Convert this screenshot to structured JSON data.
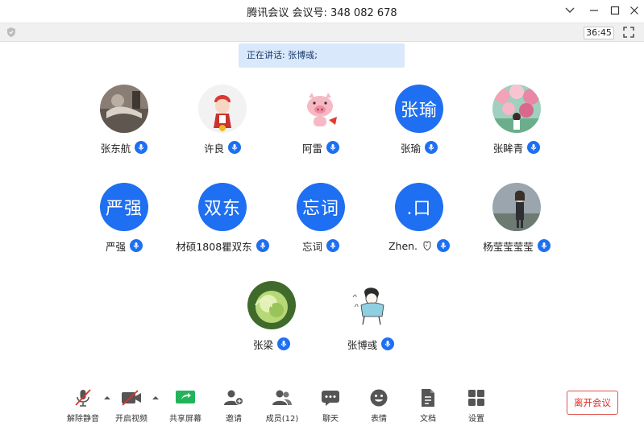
{
  "window": {
    "title_app": "腾讯会议",
    "title_meeting_label": "会议号:",
    "title_meeting_id": "348 082 678"
  },
  "subbar": {
    "timer": "36:45"
  },
  "speaking": {
    "label": "正在讲话:",
    "names": "张博彧;"
  },
  "participants": [
    {
      "name": "张东航",
      "avatar_type": "photo",
      "avatar_text": ""
    },
    {
      "name": "许良",
      "avatar_type": "photo",
      "avatar_text": ""
    },
    {
      "name": "阿雷",
      "avatar_type": "photo",
      "avatar_text": ""
    },
    {
      "name": "张瑜",
      "avatar_type": "text",
      "avatar_text": "张瑜"
    },
    {
      "name": "张眸青",
      "avatar_type": "photo",
      "avatar_text": ""
    },
    {
      "name": "严强",
      "avatar_type": "text",
      "avatar_text": "严强"
    },
    {
      "name": "材硕1808瞿双东",
      "avatar_type": "text",
      "avatar_text": "双东"
    },
    {
      "name": "忘词",
      "avatar_type": "text",
      "avatar_text": "忘词"
    },
    {
      "name": "Zhen.",
      "avatar_type": "text",
      "avatar_text": ".口"
    },
    {
      "name": "杨莹莹莹莹",
      "avatar_type": "photo",
      "avatar_text": ""
    },
    {
      "name": "张梁",
      "avatar_type": "photo",
      "avatar_text": ""
    },
    {
      "name": "张博彧",
      "avatar_type": "photo",
      "avatar_text": ""
    }
  ],
  "toolbar": {
    "unmute": "解除静音",
    "start_video": "开启视频",
    "share_screen": "共享屏幕",
    "invite": "邀请",
    "members": "成员(12)",
    "chat": "聊天",
    "emoji": "表情",
    "docs": "文档",
    "settings": "设置",
    "leave": "离开会议"
  },
  "colors": {
    "accent": "#1e6ff1",
    "speaking_bg": "#d9e8fb",
    "leave_red": "#e0302b",
    "share_green": "#23b35a"
  },
  "icons": {
    "mic": "microphone-icon",
    "mic_off": "microphone-off-icon",
    "video_off": "video-off-icon",
    "share": "share-screen-icon",
    "invite": "add-person-icon",
    "members": "people-icon",
    "chat": "chat-bubble-icon",
    "emoji": "smiley-icon",
    "docs": "document-icon",
    "settings": "grid-settings-icon"
  }
}
